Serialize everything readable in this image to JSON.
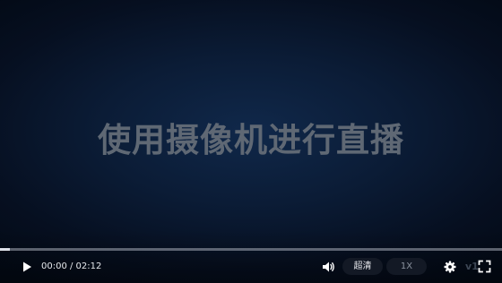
{
  "video": {
    "title": "使用摄像机进行直播"
  },
  "progress": {
    "buffered_fraction": 0.02
  },
  "controls": {
    "play_icon": "play-icon",
    "current_time": "00:00",
    "duration": "02:12",
    "time_display": "00:00 / 02:12",
    "volume_icon": "volume-icon",
    "quality_label": "超清",
    "speed_label": "1X",
    "settings_icon": "gear-icon",
    "version_label": "v1",
    "fullscreen_icon": "fullscreen-icon"
  },
  "colors": {
    "background": "#0b1c36",
    "title_text": "#5f6874",
    "control_text": "#e6e8ec"
  }
}
